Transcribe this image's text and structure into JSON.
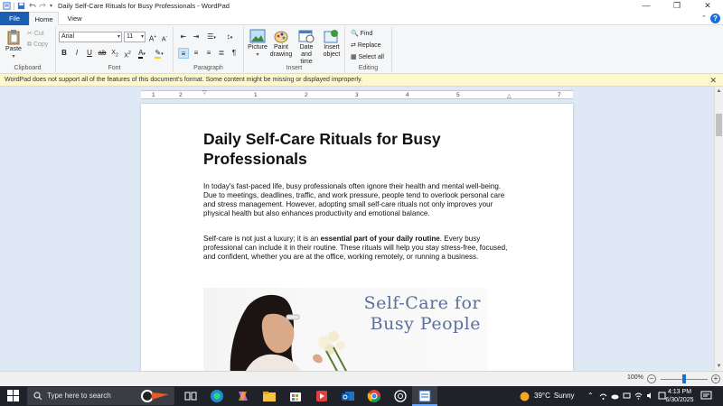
{
  "titlebar": {
    "title": "Daily Self-Care Rituals for Busy Professionals - WordPad",
    "min_icon": "minimize-icon",
    "max_icon": "restore-icon",
    "close_icon": "close-icon"
  },
  "tabs": {
    "file": "File",
    "home": "Home",
    "view": "View"
  },
  "ribbon": {
    "clipboard": {
      "label": "Clipboard",
      "paste": "Paste",
      "cut": "Cut",
      "copy": "Copy"
    },
    "font": {
      "label": "Font",
      "family": "Arial",
      "size": "11"
    },
    "paragraph": {
      "label": "Paragraph"
    },
    "insert": {
      "label": "Insert",
      "picture": "Picture",
      "paint_drawing_line1": "Paint",
      "paint_drawing_line2": "drawing",
      "date_time_line1": "Date and",
      "date_time_line2": "time",
      "insert_object_line1": "Insert",
      "insert_object_line2": "object"
    },
    "editing": {
      "label": "Editing",
      "find": "Find",
      "replace": "Replace",
      "select_all": "Select all"
    }
  },
  "notification": {
    "text": "WordPad does not support all of the features of this document's format. Some content might be missing or displayed improperly."
  },
  "ruler": {
    "numbers": [
      "1",
      "2",
      "1",
      "2",
      "3",
      "4",
      "5",
      "6",
      "7"
    ]
  },
  "document": {
    "heading": "Daily Self-Care Rituals for Busy Professionals",
    "para1": "In today's fast-paced life, busy professionals often ignore their health and mental well-being. Due to meetings, deadlines, traffic, and work pressure, people tend to overlook personal care and stress management. However, adopting small self-care rituals not only improves your physical health but also enhances productivity and emotional balance.",
    "para2_start": "Self-care is not just a luxury; it is an ",
    "para2_bold": "essential part of your daily routine",
    "para2_end": ". Every busy professional can include it in their routine. These rituals will help you stay stress-free, focused, and confident, whether you are at the office, working remotely, or running a business.",
    "image_title_line1": "Self-Care for",
    "image_title_line2": "Busy People"
  },
  "statusbar": {
    "zoom": "100%",
    "zoom_percent": 100
  },
  "taskbar": {
    "search_placeholder": "Type here to search",
    "temperature": "39°C",
    "weather": "Sunny",
    "time": "4:13 PM",
    "date": "6/30/2025"
  },
  "colors": {
    "file_tab": "#1a5fb4",
    "notification_bg": "#fdf8ce",
    "doc_bg": "#dfe9f5",
    "taskbar": "#1f2229",
    "image_title": "#5b6f9c"
  }
}
